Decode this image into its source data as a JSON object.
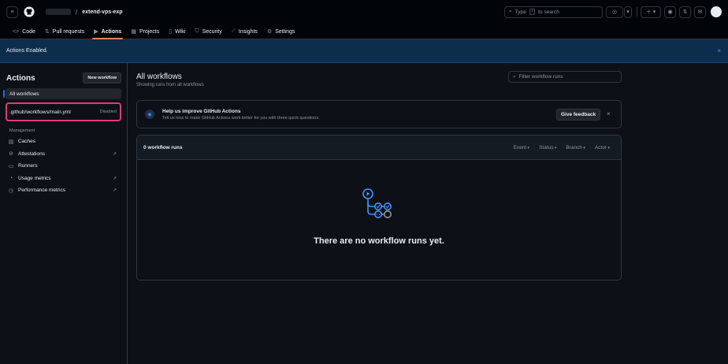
{
  "repo": {
    "name": "extend-vps-exp",
    "separator": "/"
  },
  "search": {
    "placeholder": "Type",
    "shortcut": "/",
    "placeholder_tail": "to search"
  },
  "tabs": [
    {
      "label": "Code",
      "icon": "<>"
    },
    {
      "label": "Pull requests",
      "icon": "⇅"
    },
    {
      "label": "Actions",
      "icon": "▶"
    },
    {
      "label": "Projects",
      "icon": "▦"
    },
    {
      "label": "Wiki",
      "icon": "▯"
    },
    {
      "label": "Security",
      "icon": "⛉"
    },
    {
      "label": "Insights",
      "icon": "⟋"
    },
    {
      "label": "Settings",
      "icon": "⚙"
    }
  ],
  "banner": {
    "text": "Actions Enabled.",
    "close": "×"
  },
  "sidebar": {
    "title": "Actions",
    "new_workflow": "New workflow",
    "all_workflows": "All workflows",
    "workflow": {
      "name": ".github/workflows/main.yml",
      "status": "Disabled"
    },
    "section": "Management",
    "items": [
      {
        "label": "Caches",
        "icon": "cache-icon"
      },
      {
        "label": "Attestations",
        "icon": "attestation-icon",
        "ext": "↗"
      },
      {
        "label": "Runners",
        "icon": "runners-icon"
      },
      {
        "label": "Usage metrics",
        "icon": "usage-icon",
        "ext": "↗"
      },
      {
        "label": "Performance metrics",
        "icon": "performance-icon",
        "ext": "↗"
      }
    ]
  },
  "main": {
    "title": "All workflows",
    "subtitle": "Showing runs from all workflows",
    "filter_placeholder": "Filter workflow runs",
    "feedback": {
      "title": "Help us improve GitHub Actions",
      "body": "Tell us how to make GitHub Actions work better for you with three quick questions.",
      "button": "Give feedback"
    },
    "runs": {
      "count_label": "0 workflow runs",
      "filters": [
        "Event",
        "Status",
        "Branch",
        "Actor"
      ],
      "empty": "There are no workflow runs yet."
    }
  },
  "colors": {
    "accent": "#4493f8",
    "highlight": "#e33a6e",
    "tab_underline": "#f78166"
  }
}
